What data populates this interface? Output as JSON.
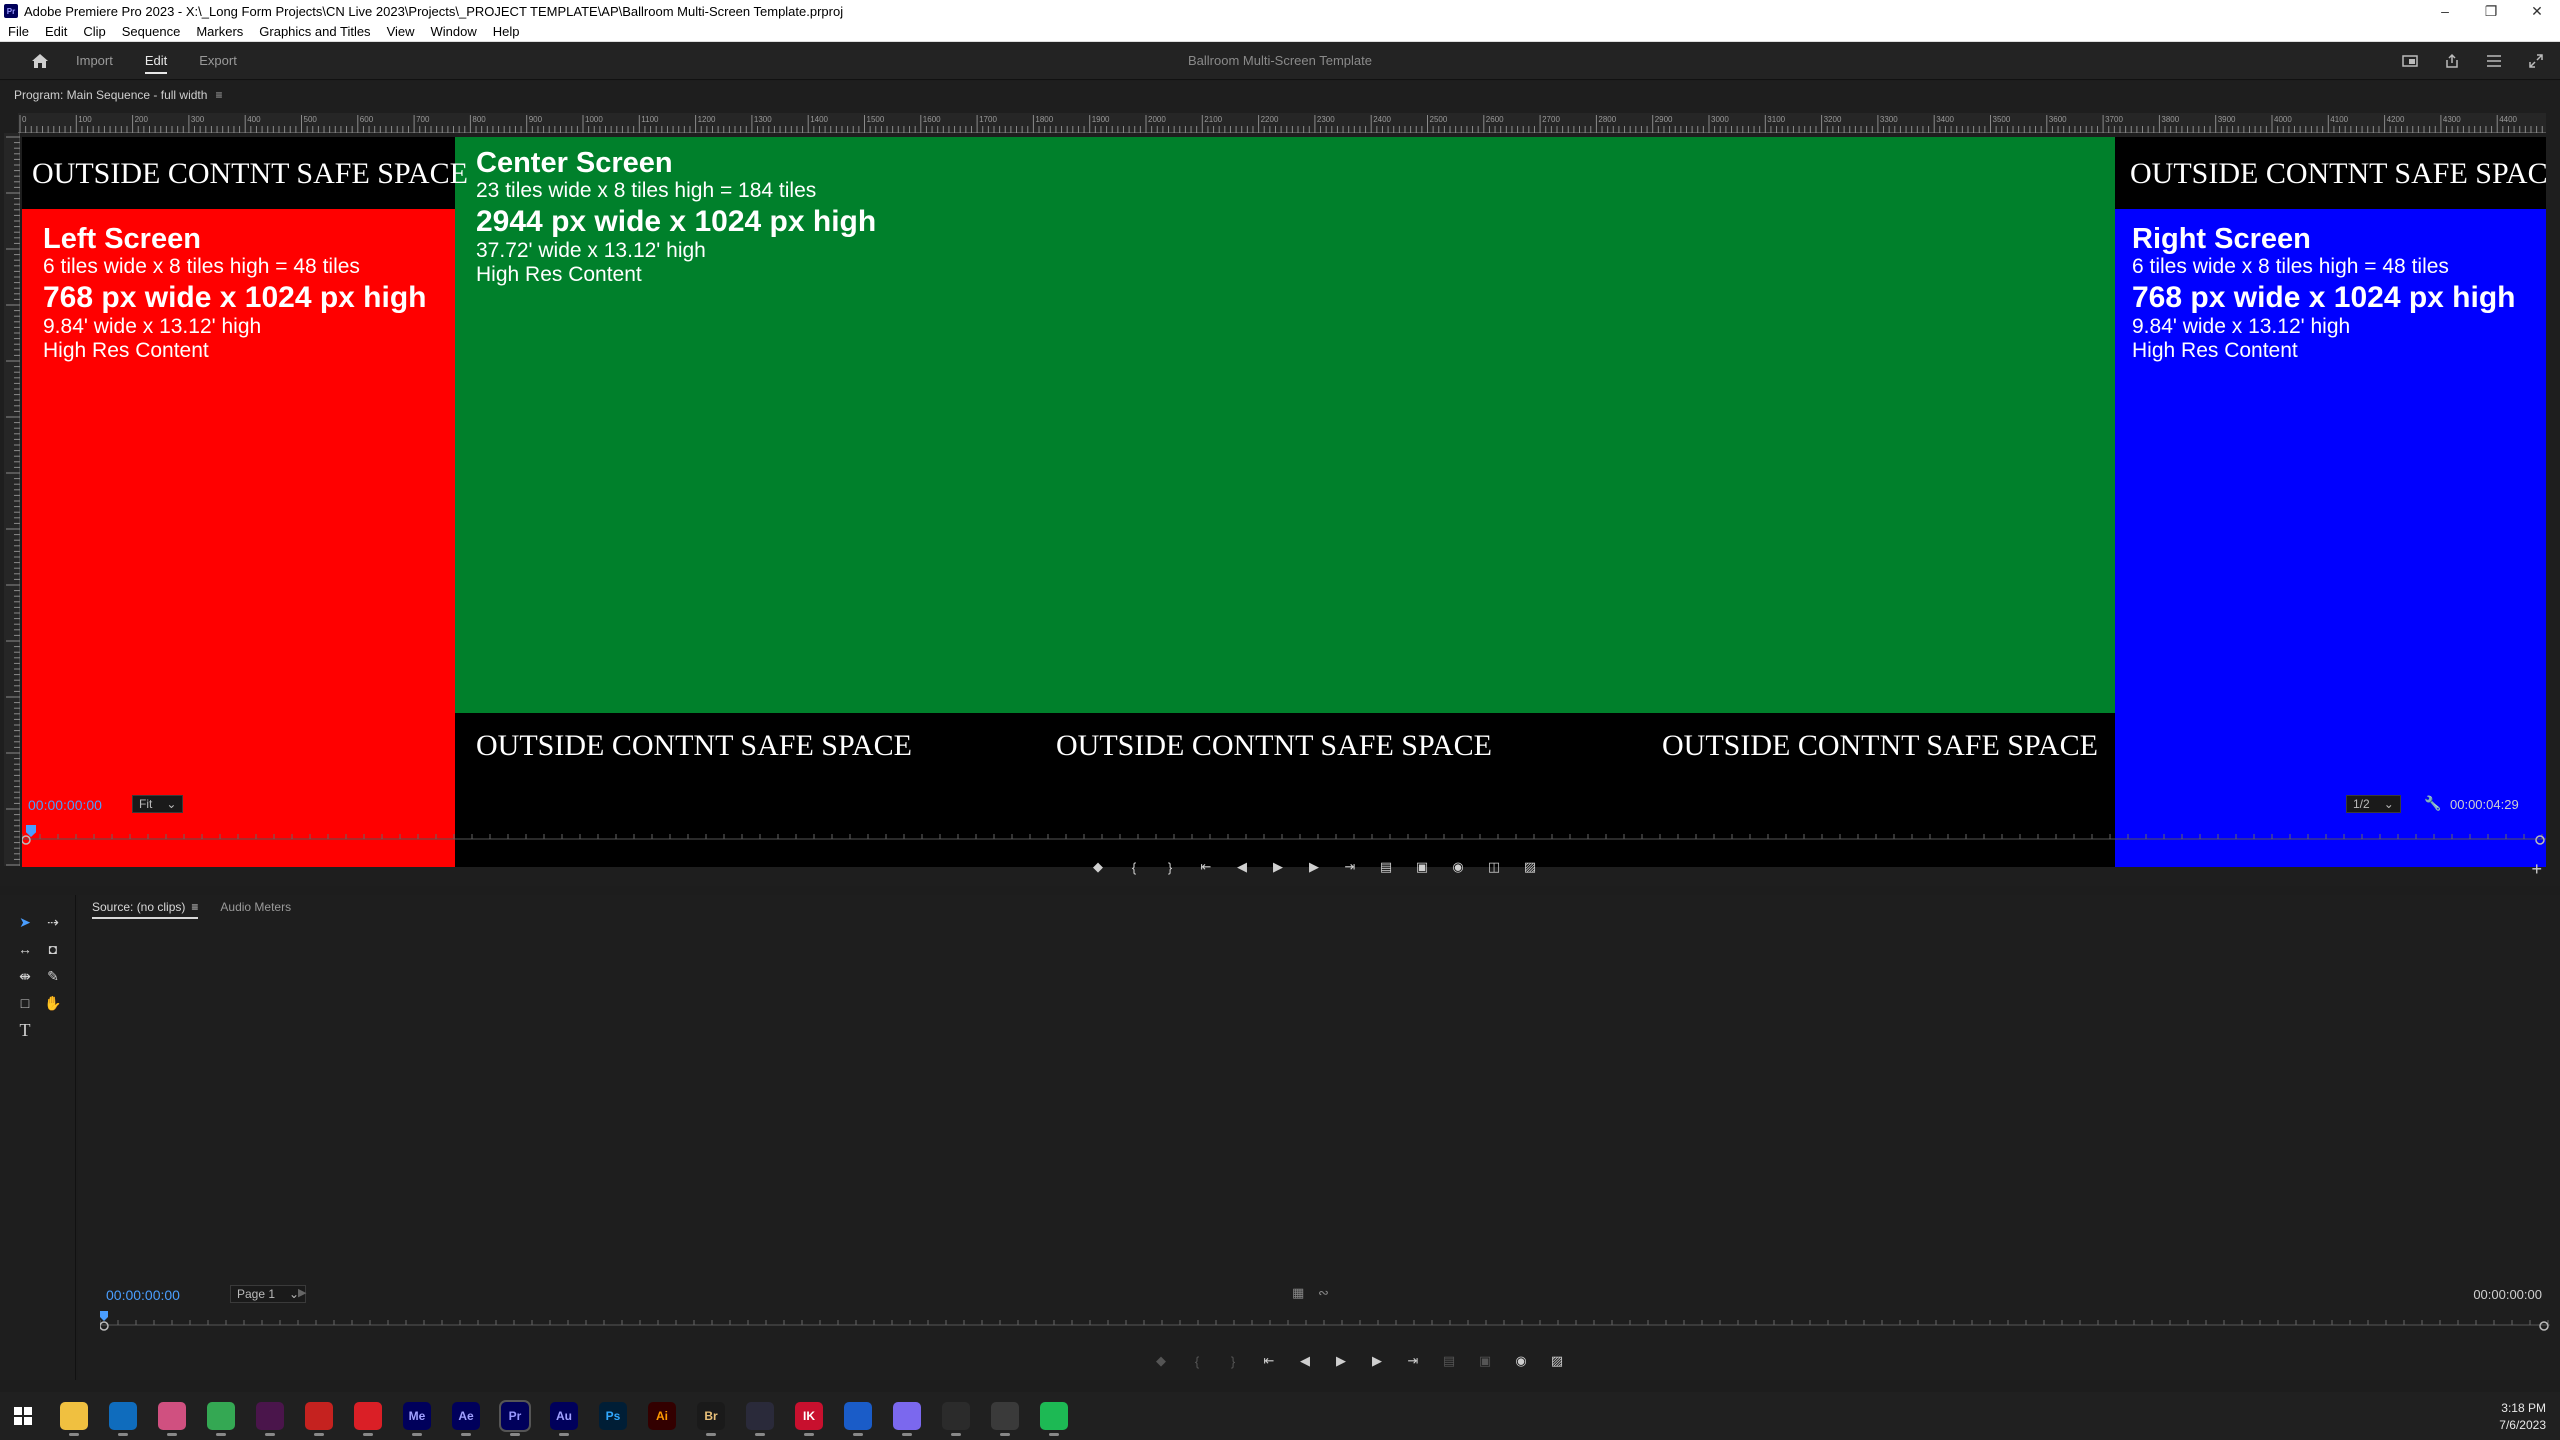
{
  "window": {
    "title": "Adobe Premiere Pro 2023 - X:\\_Long Form Projects\\CN Live 2023\\Projects\\_PROJECT TEMPLATE\\AP\\Ballroom Multi-Screen Template.prproj",
    "app_badge": "Pr"
  },
  "menu": [
    "File",
    "Edit",
    "Clip",
    "Sequence",
    "Markers",
    "Graphics and Titles",
    "View",
    "Window",
    "Help"
  ],
  "header": {
    "tabs": [
      "Import",
      "Edit",
      "Export"
    ],
    "active_tab": "Edit",
    "project_title": "Ballroom Multi-Screen Template"
  },
  "program_monitor": {
    "panel_title": "Program: Main Sequence - full width",
    "ruler_labels": [
      "0",
      "100",
      "200",
      "300",
      "400",
      "500",
      "600",
      "700",
      "800",
      "900",
      "1000",
      "1100",
      "1200",
      "1300",
      "1400",
      "1500",
      "1600",
      "1700",
      "1800",
      "1900",
      "2000",
      "2100",
      "2200",
      "2300",
      "2400",
      "2500",
      "2600",
      "2700",
      "2800",
      "2900",
      "3000",
      "3100",
      "3200",
      "3300",
      "3400",
      "3500",
      "3600",
      "3700",
      "3800",
      "3900",
      "4000",
      "4100",
      "4200",
      "4300",
      "4400"
    ],
    "left_screen": {
      "title": "Left Screen",
      "tiles": "6 tiles wide x 8 tiles high = 48 tiles",
      "pixels": "768 px wide x 1024 px high",
      "feet": "9.84' wide x 13.12' high",
      "note": "High Res Content"
    },
    "center_screen": {
      "title": "Center Screen",
      "tiles": "23 tiles wide x 8 tiles high = 184 tiles",
      "pixels": "2944 px wide x 1024 px high",
      "feet": "37.72' wide x 13.12' high",
      "note": "High Res Content"
    },
    "right_screen": {
      "title": "Right Screen",
      "tiles": "6 tiles wide x 8 tiles high = 48 tiles",
      "pixels": "768 px wide x 1024 px high",
      "feet": "9.84' wide x 13.12' high",
      "note": "High Res Content"
    },
    "safe_space_label": "OUTSIDE CONTNT SAFE SPACE",
    "timecode": "00:00:00:00",
    "zoom": "Fit",
    "resolution": "1/2",
    "duration": "00:00:04:29",
    "colors": {
      "left": "#ff0000",
      "center": "#00802b",
      "right": "#0000ff"
    }
  },
  "source_monitor": {
    "tabs": [
      "Source: (no clips)",
      "Audio Meters"
    ],
    "active_tab": "Source: (no clips)",
    "timecode_in": "00:00:00:00",
    "page": "Page 1",
    "timecode_out": "00:00:00:00"
  },
  "tools": [
    "selection-tool",
    "track-select-tool",
    "ripple-edit-tool",
    "razor-tool",
    "slip-tool",
    "pen-tool",
    "rectangle-tool",
    "hand-tool",
    "type-tool"
  ],
  "taskbar": {
    "apps": [
      {
        "name": "file-explorer",
        "label": "",
        "color": "#f0c040"
      },
      {
        "name": "outlook",
        "label": "",
        "color": "#0f6cbd"
      },
      {
        "name": "photos",
        "label": "",
        "color": "#d05080"
      },
      {
        "name": "chrome",
        "label": "",
        "color": "#34a853"
      },
      {
        "name": "slack",
        "label": "",
        "color": "#4a154b"
      },
      {
        "name": "gmail",
        "label": "",
        "color": "#c5221f"
      },
      {
        "name": "creative-cloud",
        "label": "",
        "color": "#da1f26"
      },
      {
        "name": "media-encoder",
        "label": "Me",
        "color": "#00005b"
      },
      {
        "name": "after-effects",
        "label": "Ae",
        "color": "#00005b"
      },
      {
        "name": "premiere-pro",
        "label": "Pr",
        "color": "#00005b"
      },
      {
        "name": "audition",
        "label": "Au",
        "color": "#00005b"
      },
      {
        "name": "photoshop",
        "label": "Ps",
        "color": "#001e36"
      },
      {
        "name": "illustrator",
        "label": "Ai",
        "color": "#330000"
      },
      {
        "name": "bridge",
        "label": "Br",
        "color": "#1a1a1a"
      },
      {
        "name": "frame-io",
        "label": "",
        "color": "#2a2a3a"
      },
      {
        "name": "app-ik",
        "label": "IK",
        "color": "#c8102e"
      },
      {
        "name": "1password",
        "label": "",
        "color": "#1a5cc8"
      },
      {
        "name": "app-purple",
        "label": "",
        "color": "#7b68ee"
      },
      {
        "name": "davinci-resolve",
        "label": "",
        "color": "#2b2b2b"
      },
      {
        "name": "app-router",
        "label": "",
        "color": "#3a3a3a"
      },
      {
        "name": "spotify",
        "label": "",
        "color": "#1db954"
      }
    ],
    "time": "3:18 PM",
    "date": "7/6/2023"
  }
}
